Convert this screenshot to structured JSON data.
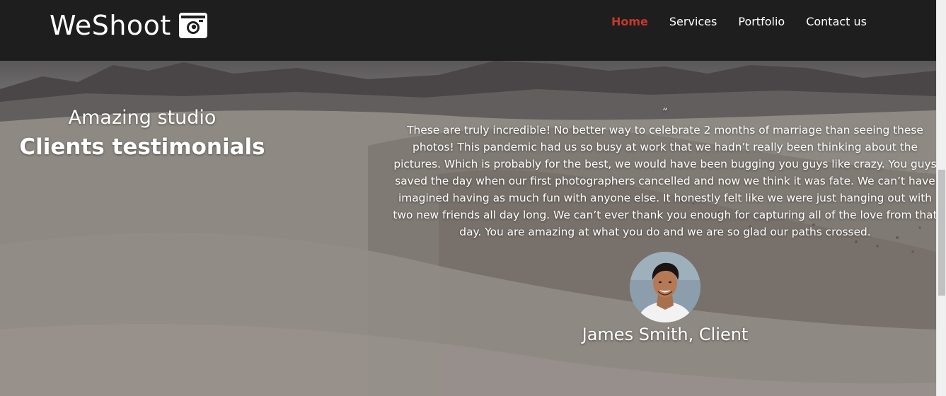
{
  "brand": {
    "name": "WeShoot",
    "icon": "camera-icon"
  },
  "nav": {
    "items": [
      {
        "label": "Home",
        "active": true
      },
      {
        "label": "Services",
        "active": false
      },
      {
        "label": "Portfolio",
        "active": false
      },
      {
        "label": "Contact us",
        "active": false
      }
    ]
  },
  "intro": {
    "subtitle": "Amazing studio",
    "title": "Clients testimonials"
  },
  "testimonial": {
    "quote_mark": "“",
    "text": "These are truly incredible! No better way to celebrate 2 months of marriage than seeing these photos! This pandemic had us so busy at work that we hadn’t really been thinking about the pictures. Which is probably for the best, we would have been bugging you guys like crazy. You guys saved the day when our first photographers cancelled and now we think it was fate. We can’t have imagined having as much fun with anyone else. It honestly felt like we were just hanging out with two new friends all day long. We can’t ever thank you enough for capturing all of the love from that day. You are amazing at what you do and we are so glad our paths crossed.",
    "client_name": "James Smith, Client"
  },
  "colors": {
    "header_bg": "#1e1e1e",
    "accent": "#c8372d",
    "text": "#ffffff"
  }
}
